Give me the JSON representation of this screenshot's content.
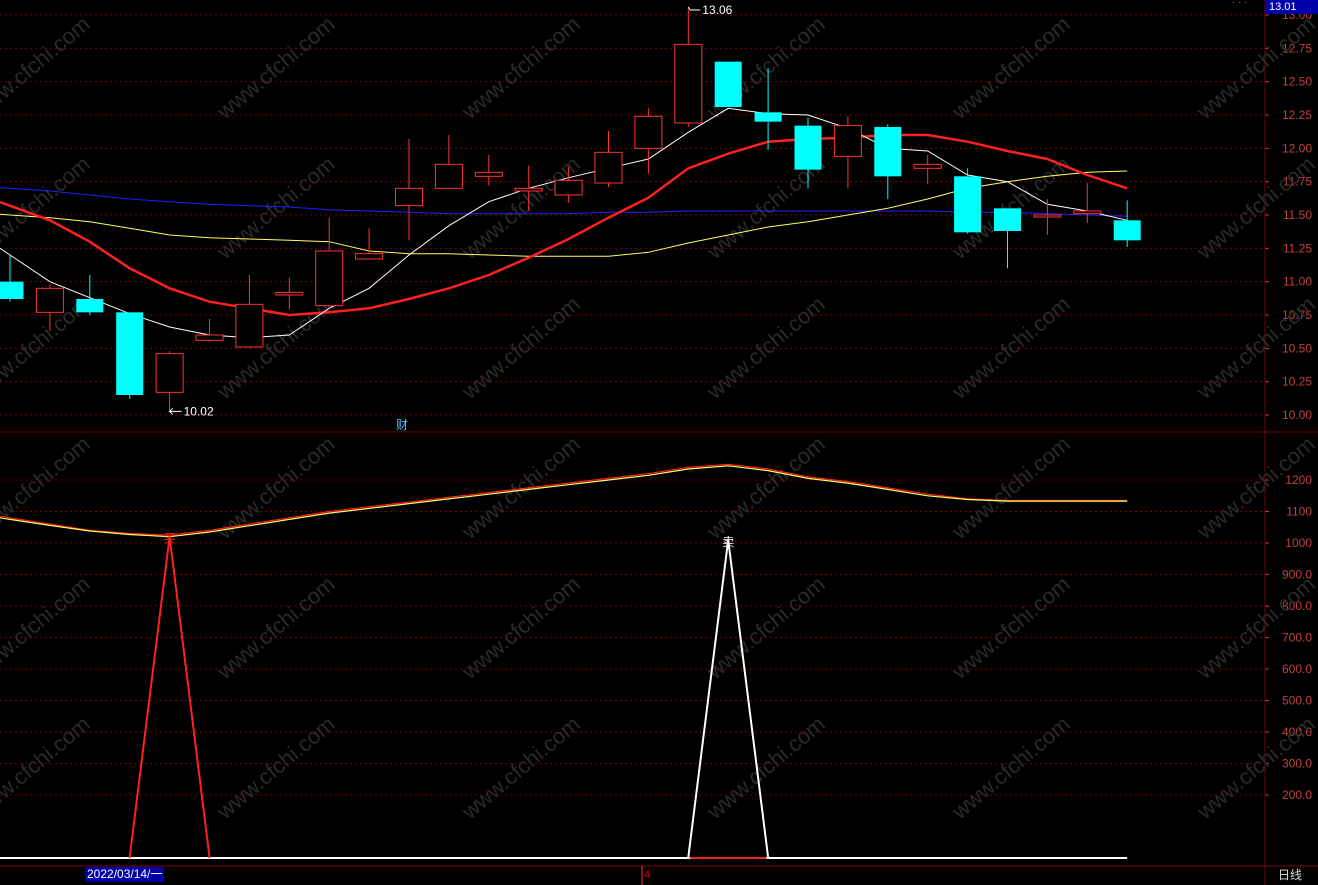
{
  "window": {
    "title_dots": "· · ·"
  },
  "price_badge": "13.01",
  "date_badge": "2022/03/14/一",
  "period_label": "日线",
  "cursor_label": "4",
  "financial_tag": "财",
  "colors": {
    "background": "#000000",
    "up_candle": "#ff3232",
    "down_candle": "#00ffff",
    "ma_white": "#ffffff",
    "ma_red": "#ff2020",
    "ma_yellow": "#ffff60",
    "ma_blue": "#2020ff",
    "grid": "#7a0000",
    "axis_text": "#c04040"
  },
  "chart_data": [
    {
      "type": "candlestick",
      "panel": "price",
      "y_ticks": [
        "13.00",
        "12.75",
        "12.50",
        "12.25",
        "12.00",
        "11.75",
        "11.50",
        "11.25",
        "11.00",
        "10.75",
        "10.50",
        "10.25",
        "10.00"
      ],
      "ylim": [
        9.9,
        13.1
      ],
      "high_annotation": {
        "label": "13.06",
        "value": 13.06,
        "candle_index": 17
      },
      "low_annotation": {
        "label": "10.02",
        "value": 10.02,
        "candle_index": 4
      },
      "candles": [
        {
          "open": 11.0,
          "close": 10.87,
          "high": 11.2,
          "low": 10.85
        },
        {
          "open": 10.77,
          "close": 10.95,
          "high": 10.98,
          "low": 10.63
        },
        {
          "open": 10.87,
          "close": 10.77,
          "high": 11.05,
          "low": 10.75
        },
        {
          "open": 10.77,
          "close": 10.15,
          "high": 10.77,
          "low": 10.12
        },
        {
          "open": 10.17,
          "close": 10.46,
          "high": 10.48,
          "low": 10.02
        },
        {
          "open": 10.56,
          "close": 10.6,
          "high": 10.72,
          "low": 10.55
        },
        {
          "open": 10.51,
          "close": 10.83,
          "high": 11.05,
          "low": 10.5
        },
        {
          "open": 10.9,
          "close": 10.92,
          "high": 11.03,
          "low": 10.79
        },
        {
          "open": 10.82,
          "close": 11.23,
          "high": 11.48,
          "low": 10.8
        },
        {
          "open": 11.17,
          "close": 11.21,
          "high": 11.4,
          "low": 11.17
        },
        {
          "open": 11.57,
          "close": 11.7,
          "high": 12.07,
          "low": 11.31
        },
        {
          "open": 11.7,
          "close": 11.88,
          "high": 12.1,
          "low": 11.7
        },
        {
          "open": 11.79,
          "close": 11.82,
          "high": 11.95,
          "low": 11.72
        },
        {
          "open": 11.68,
          "close": 11.7,
          "high": 11.87,
          "low": 11.53
        },
        {
          "open": 11.65,
          "close": 11.76,
          "high": 11.86,
          "low": 11.59
        },
        {
          "open": 11.74,
          "close": 11.97,
          "high": 12.13,
          "low": 11.71
        },
        {
          "open": 12.0,
          "close": 12.24,
          "high": 12.3,
          "low": 11.81
        },
        {
          "open": 12.19,
          "close": 12.78,
          "high": 13.06,
          "low": 12.16
        },
        {
          "open": 12.65,
          "close": 12.31,
          "high": 12.65,
          "low": 12.31
        },
        {
          "open": 12.27,
          "close": 12.2,
          "high": 12.6,
          "low": 11.99
        },
        {
          "open": 12.17,
          "close": 11.84,
          "high": 12.23,
          "low": 11.7
        },
        {
          "open": 11.94,
          "close": 12.17,
          "high": 12.24,
          "low": 11.7
        },
        {
          "open": 12.16,
          "close": 11.79,
          "high": 12.18,
          "low": 11.62
        },
        {
          "open": 11.85,
          "close": 11.88,
          "high": 11.95,
          "low": 11.73
        },
        {
          "open": 11.79,
          "close": 11.37,
          "high": 11.85,
          "low": 11.36
        },
        {
          "open": 11.55,
          "close": 11.38,
          "high": 11.55,
          "low": 11.1
        },
        {
          "open": 11.49,
          "close": 11.5,
          "high": 11.62,
          "low": 11.35
        },
        {
          "open": 11.51,
          "close": 11.53,
          "high": 11.74,
          "low": 11.44
        },
        {
          "open": 11.46,
          "close": 11.31,
          "high": 11.61,
          "low": 11.26
        }
      ],
      "series": [
        {
          "color": "ma_white",
          "values": [
            11.2,
            11.0,
            10.88,
            10.76,
            10.66,
            10.6,
            10.58,
            10.6,
            10.8,
            10.95,
            11.2,
            11.42,
            11.6,
            11.7,
            11.78,
            11.85,
            11.92,
            12.12,
            12.3,
            12.26,
            12.25,
            12.15,
            12.0,
            11.98,
            11.8,
            11.75,
            11.58,
            11.53,
            11.46
          ]
        },
        {
          "color": "ma_red",
          "values": [
            11.57,
            11.46,
            11.3,
            11.1,
            10.95,
            10.85,
            10.8,
            10.75,
            10.77,
            10.8,
            10.87,
            10.95,
            11.05,
            11.18,
            11.32,
            11.48,
            11.63,
            11.85,
            11.96,
            12.05,
            12.07,
            12.08,
            12.1,
            12.1,
            12.05,
            11.98,
            11.92,
            11.8,
            11.7
          ]
        },
        {
          "color": "ma_yellow",
          "values": [
            11.5,
            11.48,
            11.45,
            11.4,
            11.35,
            11.33,
            11.32,
            11.31,
            11.3,
            11.23,
            11.21,
            11.21,
            11.2,
            11.19,
            11.19,
            11.19,
            11.22,
            11.29,
            11.35,
            11.41,
            11.45,
            11.5,
            11.55,
            11.62,
            11.7,
            11.75,
            11.79,
            11.82,
            11.83
          ]
        },
        {
          "color": "ma_blue",
          "values": [
            11.7,
            11.68,
            11.65,
            11.62,
            11.6,
            11.58,
            11.57,
            11.56,
            11.54,
            11.53,
            11.52,
            11.51,
            11.51,
            11.51,
            11.51,
            11.52,
            11.52,
            11.53,
            11.53,
            11.53,
            11.53,
            11.53,
            11.53,
            11.53,
            11.52,
            11.52,
            11.51,
            11.5,
            11.49
          ]
        }
      ]
    },
    {
      "type": "line",
      "panel": "indicator",
      "y_ticks": [
        "1200",
        "1100",
        "1000",
        "900.0",
        "800.0",
        "700.0",
        "600.0",
        "500.0",
        "400.0",
        "300.0",
        "200.0"
      ],
      "ylim": [
        0,
        1300
      ],
      "signals": [
        {
          "label": "买",
          "candle_index": 4,
          "value": 1020,
          "color": "ma_red"
        },
        {
          "label": "卖",
          "candle_index": 18,
          "value": 1010,
          "color": "ma_white"
        }
      ],
      "series": [
        {
          "color": "ma_red",
          "values": [
            1080,
            1060,
            1040,
            1030,
            1025,
            1040,
            1060,
            1080,
            1100,
            1115,
            1130,
            1145,
            1160,
            1175,
            1190,
            1205,
            1220,
            1240,
            1250,
            1235,
            1210,
            1195,
            1175,
            1155,
            1140,
            1135,
            1135,
            1135,
            1135
          ]
        },
        {
          "color": "ma_yellow",
          "values": [
            1075,
            1056,
            1038,
            1027,
            1020,
            1035,
            1055,
            1075,
            1095,
            1110,
            1125,
            1140,
            1155,
            1170,
            1185,
            1200,
            1215,
            1235,
            1245,
            1230,
            1205,
            1190,
            1170,
            1150,
            1138,
            1133,
            1133,
            1133,
            1133
          ]
        }
      ]
    }
  ]
}
